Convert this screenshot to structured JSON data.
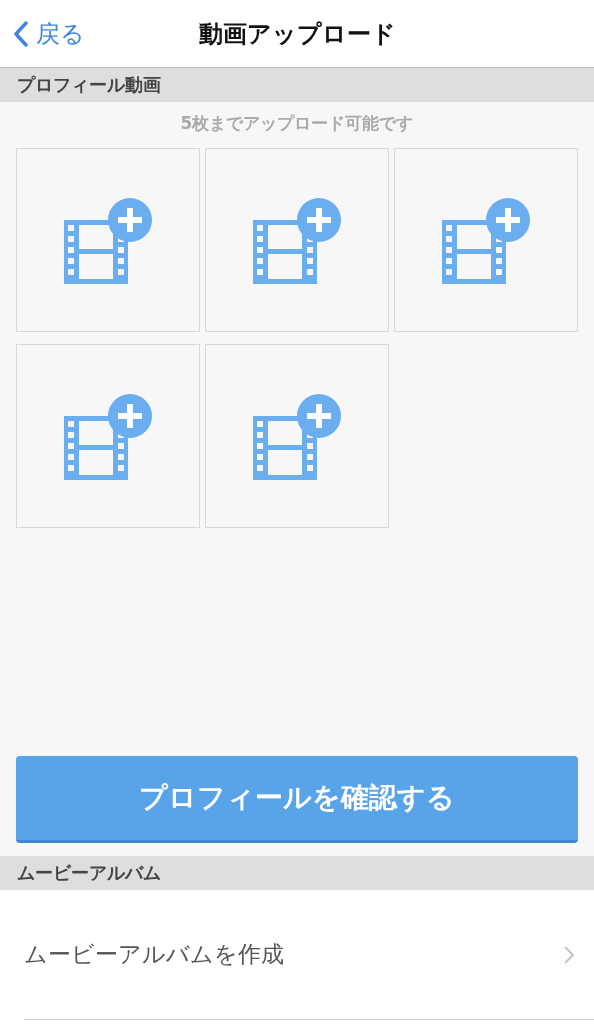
{
  "nav": {
    "back_label": "戻る",
    "title": "動画アップロード"
  },
  "profile_videos": {
    "header": "プロフィール動画",
    "note": "5枚までアップロード可能です",
    "slots": [
      {
        "kind": "add"
      },
      {
        "kind": "add"
      },
      {
        "kind": "add"
      },
      {
        "kind": "add"
      },
      {
        "kind": "add"
      }
    ]
  },
  "confirm_button": "プロフィールを確認する",
  "movie_album": {
    "header": "ムービーアルバム",
    "items": [
      {
        "label": "ムービーアルバムを作成"
      }
    ]
  }
}
